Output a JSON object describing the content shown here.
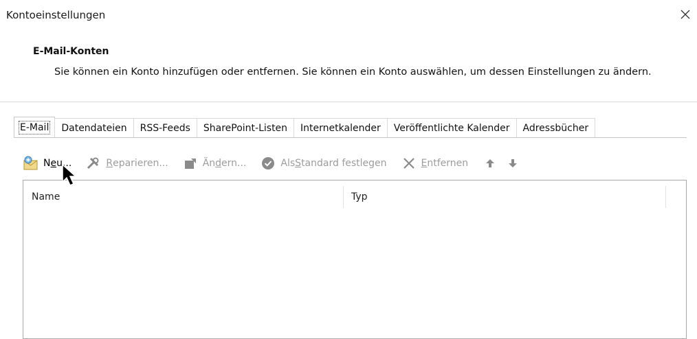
{
  "window": {
    "title": "Kontoeinstellungen",
    "close_icon": "close-icon"
  },
  "section": {
    "heading": "E-Mail-Konten",
    "description": "Sie können ein Konto hinzufügen oder entfernen. Sie können ein Konto auswählen, um dessen Einstellungen zu ändern."
  },
  "tabs": [
    {
      "label": "E-Mail",
      "active": true
    },
    {
      "label": "Datendateien"
    },
    {
      "label": "RSS-Feeds"
    },
    {
      "label": "SharePoint-Listen"
    },
    {
      "label": "Internetkalender"
    },
    {
      "label": "Veröffentlichte Kalender"
    },
    {
      "label": "Adressbücher"
    }
  ],
  "toolbar": {
    "new": {
      "pre": "N",
      "accel": "e",
      "post": "u...",
      "icon": "new-account-envelope-icon"
    },
    "repair": {
      "pre": "",
      "accel": "R",
      "post": "eparieren...",
      "icon": "repair-tools-icon",
      "disabled": true
    },
    "change": {
      "pre": "Än",
      "accel": "d",
      "post": "ern...",
      "icon": "change-settings-icon",
      "disabled": true
    },
    "set_default": {
      "pre": "Als ",
      "accel": "S",
      "post": "tandard festlegen",
      "icon": "checkmark-circle-icon",
      "disabled": true
    },
    "remove": {
      "pre": "",
      "accel": "E",
      "post": "ntfernen",
      "icon": "remove-x-icon",
      "disabled": true
    },
    "move_up_icon": "arrow-up-icon",
    "move_down_icon": "arrow-down-icon"
  },
  "list": {
    "columns": [
      "Name",
      "Typ"
    ],
    "rows": []
  },
  "colors": {
    "disabled_text": "#9c9c9c",
    "border": "#a8a8a8"
  }
}
